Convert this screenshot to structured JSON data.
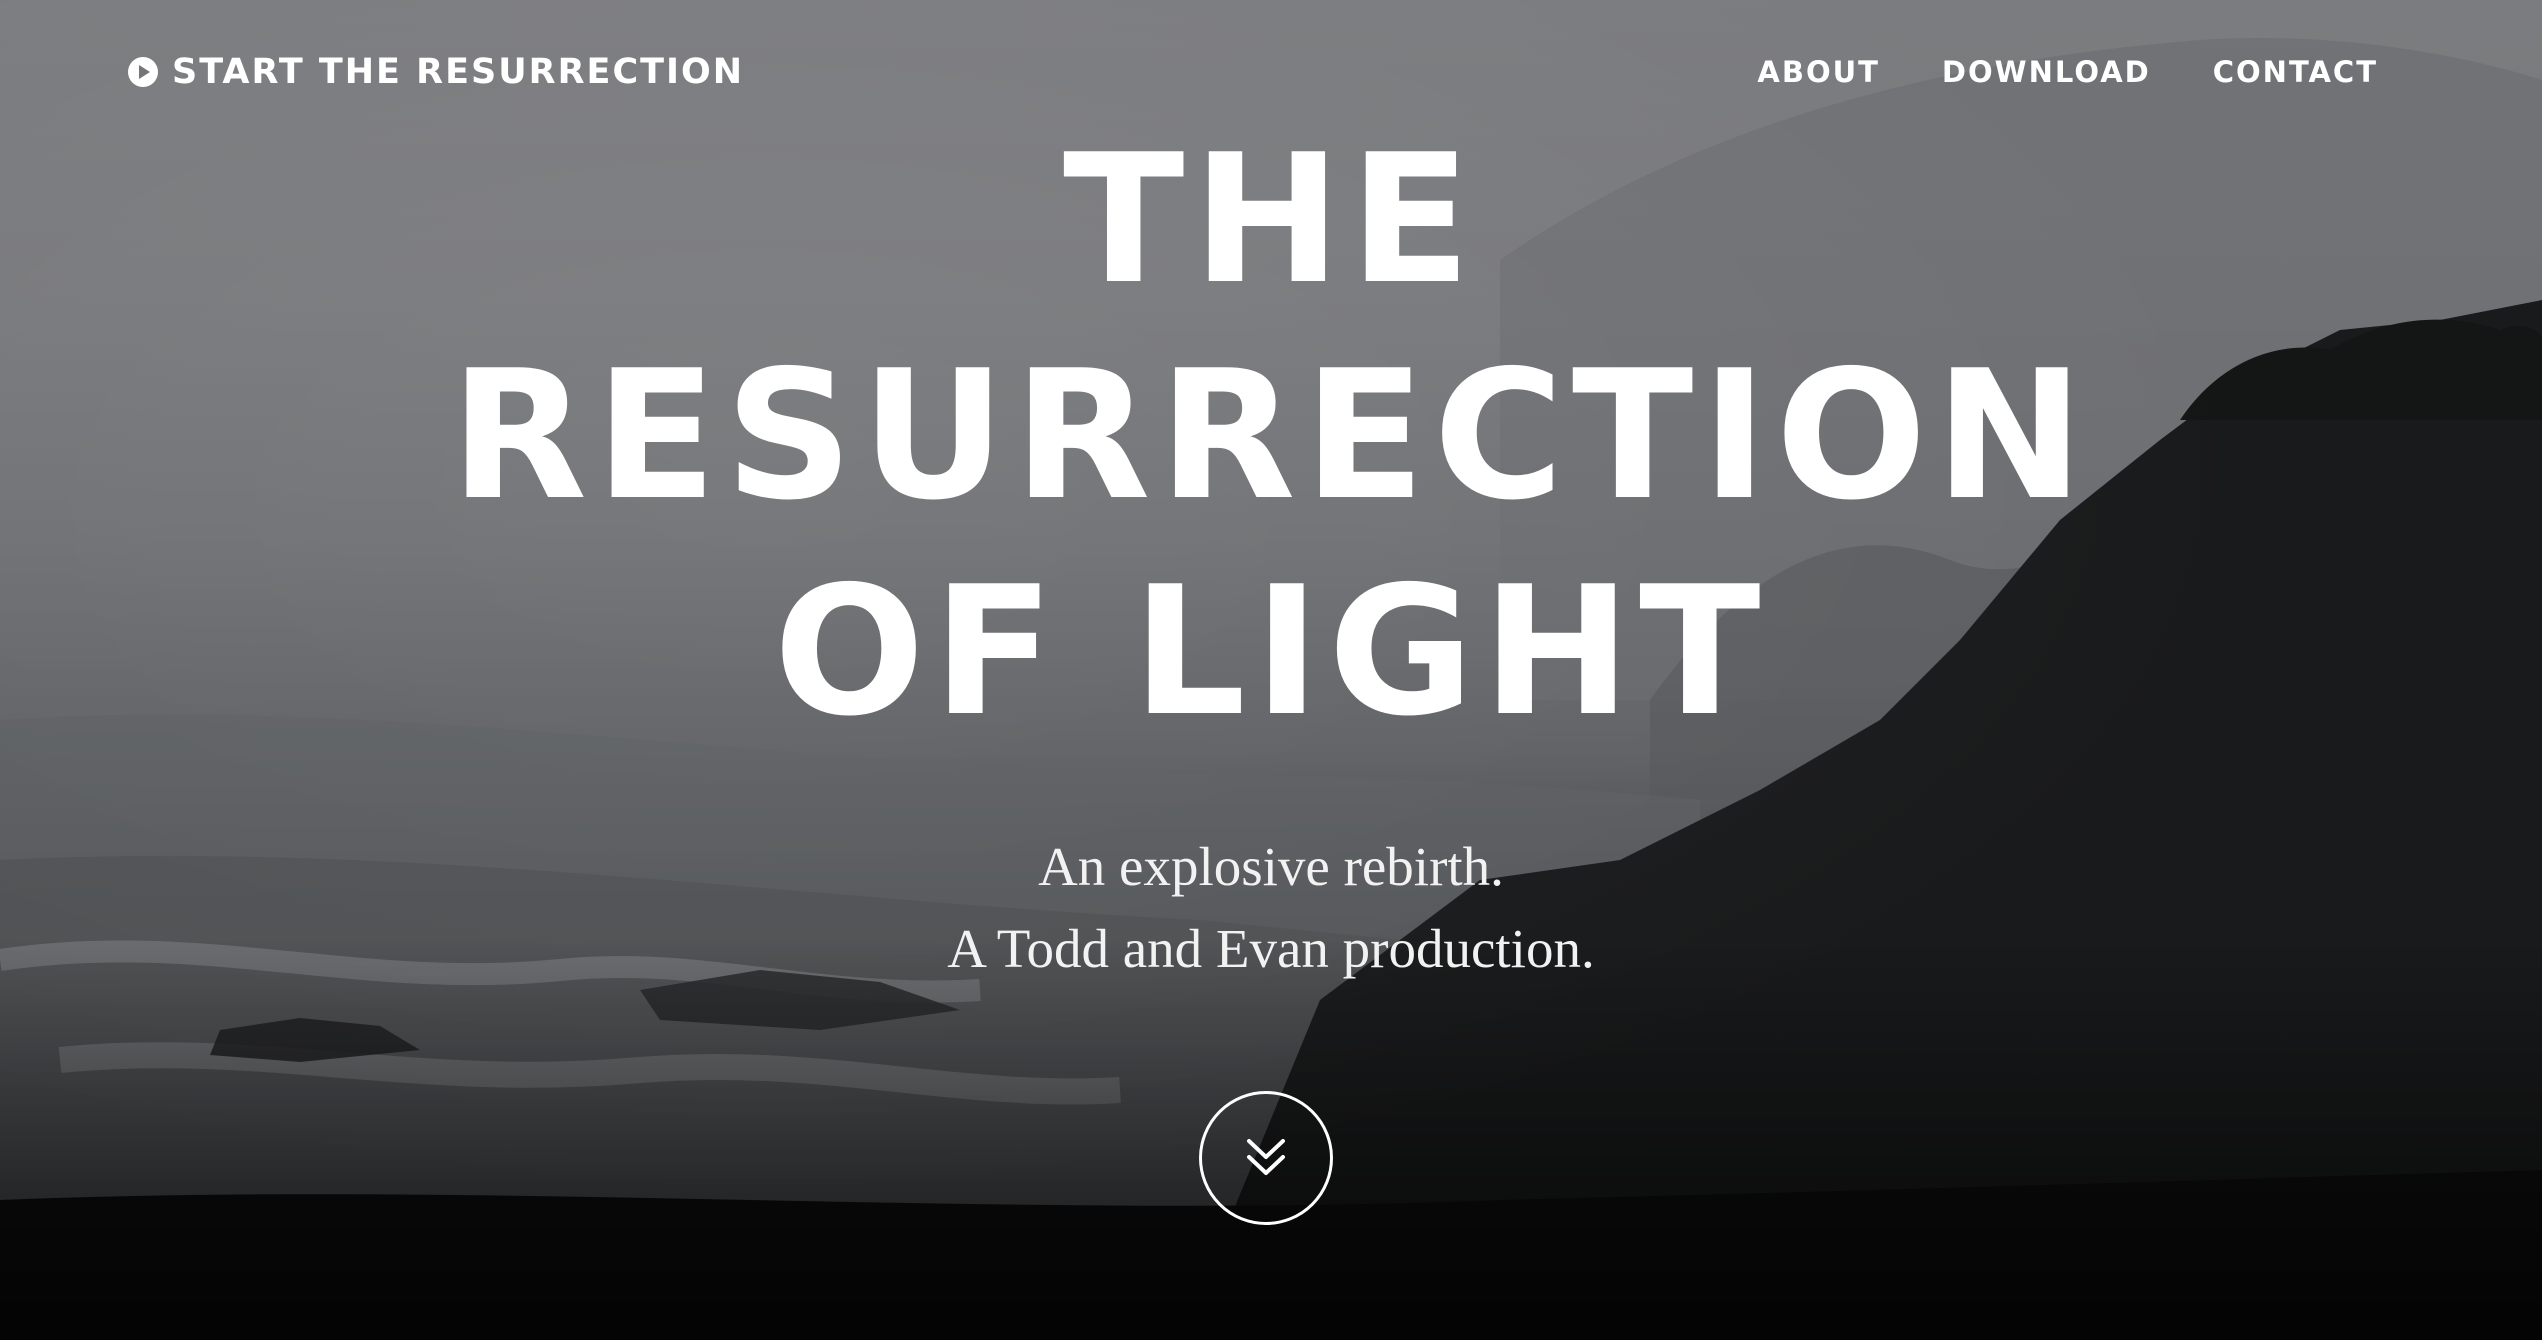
{
  "nav": {
    "brand": "START THE RESURRECTION",
    "brand_icon": "play-circle-icon",
    "links": [
      "ABOUT",
      "DOWNLOAD",
      "CONTACT"
    ]
  },
  "hero": {
    "title_lines": [
      "THE",
      "RESURRECTION",
      "OF LIGHT"
    ],
    "tagline_lines": [
      "An explosive rebirth.",
      "A Todd and Evan production."
    ],
    "scroll_icon": "double-chevron-down-icon"
  },
  "colors": {
    "text": "#ffffff",
    "sky": "#7b7c7f",
    "dark": "#0d0d0e"
  }
}
